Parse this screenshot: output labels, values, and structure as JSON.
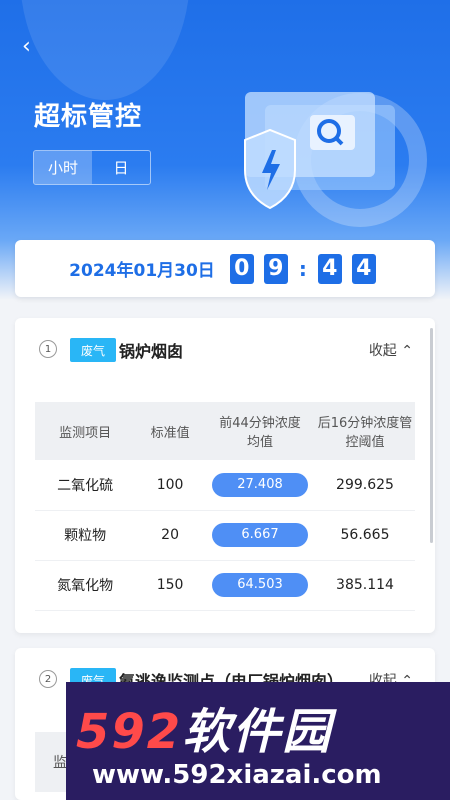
{
  "header": {
    "back_icon": "chevron-left-icon",
    "title": "超标管控"
  },
  "tabs": [
    {
      "label": "小时",
      "active": true
    },
    {
      "label": "日",
      "active": false
    }
  ],
  "timebar": {
    "date": "2024年01月30日",
    "digits": [
      "0",
      "9",
      "4",
      "4"
    ],
    "separator": ":"
  },
  "card1": {
    "index": "1",
    "badge": "废气",
    "site": "锅炉烟囱",
    "collapse_label": "收起",
    "columns": [
      "监测项目",
      "标准值",
      "前44分钟浓度均值",
      "后16分钟浓度管控阈值"
    ],
    "rows": [
      {
        "item": "二氧化硫",
        "standard": "100",
        "avg": "27.408",
        "threshold": "299.625"
      },
      {
        "item": "颗粒物",
        "standard": "20",
        "avg": "6.667",
        "threshold": "56.665"
      },
      {
        "item": "氮氧化物",
        "standard": "150",
        "avg": "64.503",
        "threshold": "385.114"
      }
    ]
  },
  "card2": {
    "index": "2",
    "badge": "废气",
    "site": "氨逃逸监测点（电厂锅炉烟囱）",
    "collapse_label": "收起",
    "peek_text": "监"
  },
  "watermark": {
    "brand_num": "592",
    "brand_text": "软件园",
    "url": "www.592xiazai.com"
  },
  "colors": {
    "primary": "#1e6ee6",
    "badge": "#29b6f6",
    "pill": "#4f8ff5"
  }
}
